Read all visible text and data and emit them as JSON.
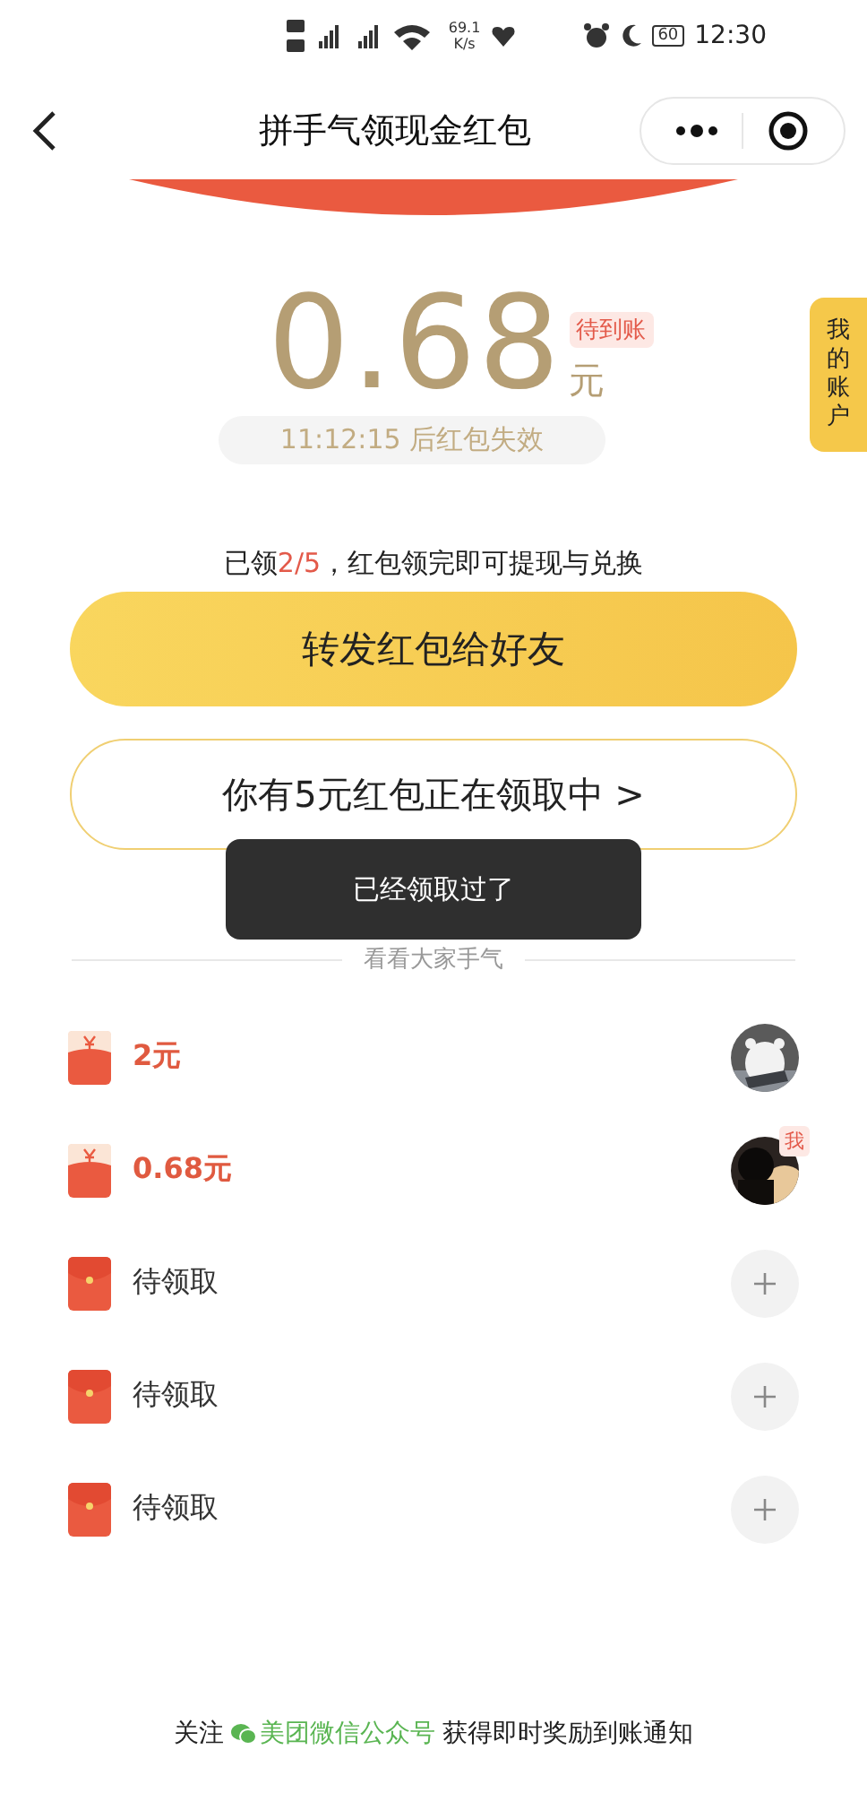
{
  "status_bar": {
    "net_speed": "69.1",
    "net_unit": "K/s",
    "battery": "60",
    "time": "12:30"
  },
  "nav": {
    "title": "拼手气领现金红包"
  },
  "side_tab": {
    "label": "我的账户"
  },
  "amount": {
    "value": "0.68",
    "unit": "元",
    "badge": "待到账"
  },
  "timer": "11:12:15 后红包失效",
  "progress": {
    "text": "已领**2/5**，红包领完即可提现与兑换"
  },
  "share_button": "转发红包给好友",
  "pending_button": "你有5元红包正在领取中 >",
  "toast": "已经领取过了",
  "section_title": "看看大家手气",
  "rows": [
    {
      "kind": "claimed",
      "text": "2元",
      "me": false
    },
    {
      "kind": "claimed",
      "text": "0.68元",
      "me": true,
      "me_label": "我"
    },
    {
      "kind": "pending",
      "text": "待领取"
    },
    {
      "kind": "pending",
      "text": "待领取"
    },
    {
      "kind": "pending",
      "text": "待领取"
    }
  ],
  "footer": {
    "prefix": "关注",
    "link": "美团微信公众号",
    "suffix": "获得即时奖励到账通知"
  }
}
